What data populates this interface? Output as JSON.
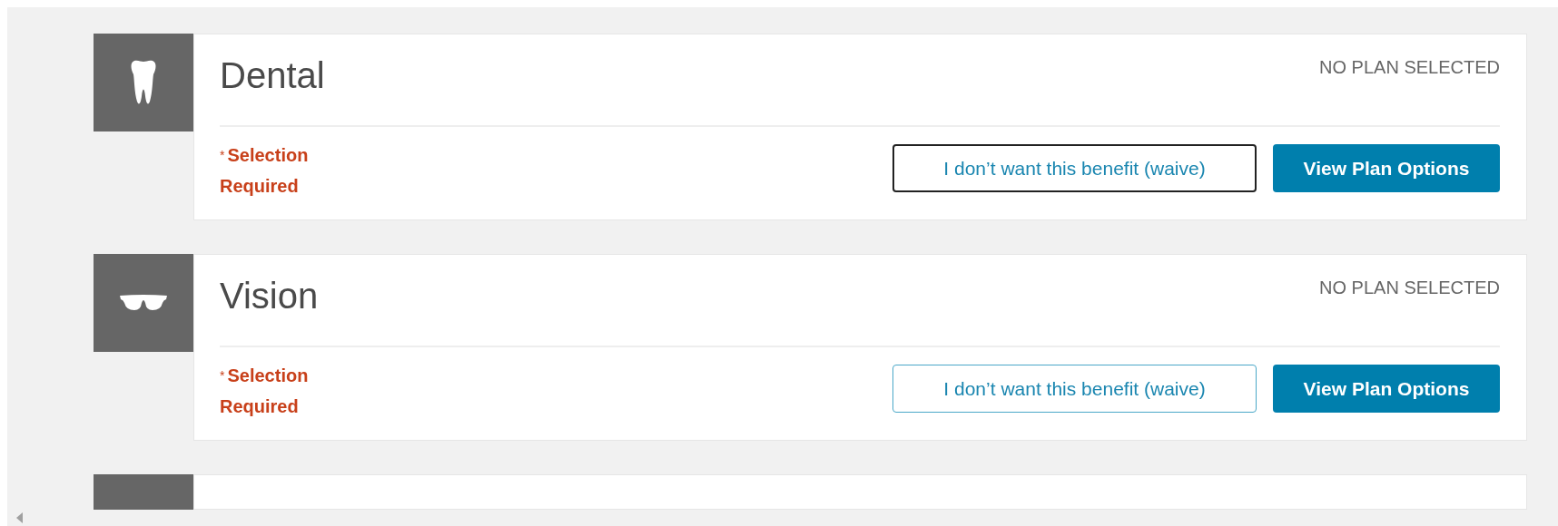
{
  "benefits": [
    {
      "kind": "tooth",
      "title": "Dental",
      "status": "NO PLAN SELECTED",
      "required_mark": "*",
      "required_text": "Selection Required",
      "waive_button": {
        "label": "I don’t want this benefit (waive)",
        "focused": true
      },
      "options_button": "View Plan Options"
    },
    {
      "kind": "glasses",
      "title": "Vision",
      "status": "NO PLAN SELECTED",
      "required_mark": "*",
      "required_text": "Selection Required",
      "waive_button": {
        "label": "I don’t want this benefit (waive)",
        "focused": false
      },
      "options_button": "View Plan Options"
    }
  ]
}
